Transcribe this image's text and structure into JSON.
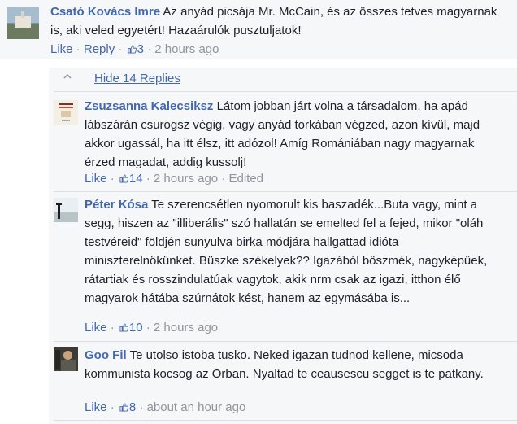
{
  "thread": {
    "top_comment": {
      "author": "Csató Kovács Imre",
      "text": "Az anyád picsája Mr. McCain, és az összes tetves magyarnak is, aki veled egyetért! Hazaárulók pusztuljatok!",
      "like_label": "Like",
      "reply_label": "Reply",
      "like_count": "3",
      "time": "2 hours ago"
    },
    "hide_replies_label": "Hide 14 Replies",
    "replies": [
      {
        "author": "Zsuzsanna Kalecsiksz",
        "text": "Látom jobban járt volna a társadalom, ha apád lábszárán csurogsz végig, vagy anyád torkában végzed, azon kívül, majd akkor ugassál, ha itt élsz, itt adózol! Amíg Romániában nagy magyarnak érzed magadat, addig kussolj!",
        "like_label": "Like",
        "like_count": "14",
        "time": "2 hours ago",
        "edited": "Edited"
      },
      {
        "author": "Péter Kósa",
        "text": "Te szerencsétlen nyomorult kis baszadék...Buta vagy, mint a segg, hiszen az \"illiberális\" szó hallatán se emelted fel a fejed, mikor \"oláh testvéreid\" földjén sunyulva birka módjára hallgattad idióta miniszterelnökünket. Büszke székelyek?? Igazából böszmék, nagyképűek, rátartiak és rosszindulatúak vagytok, akik nrm csak az igazi, itthon élő magyarok hátába szúrnátok kést, hanem az egymásába is...",
        "like_label": "Like",
        "like_count": "10",
        "time": "2 hours ago"
      },
      {
        "author": "Goo Fil",
        "text": "Te utolso istoba tusko. Neked igazan tudnod kellene, micsoda kommunista kocsog az Orban. Nyaltad te ceausescu segget is te patkany.",
        "like_label": "Like",
        "like_count": "8",
        "time": "about an hour ago"
      }
    ]
  },
  "colors": {
    "link": "#4267b2",
    "meta": "#90949c",
    "text": "#1d2129",
    "panel": "#f6f7f9"
  }
}
